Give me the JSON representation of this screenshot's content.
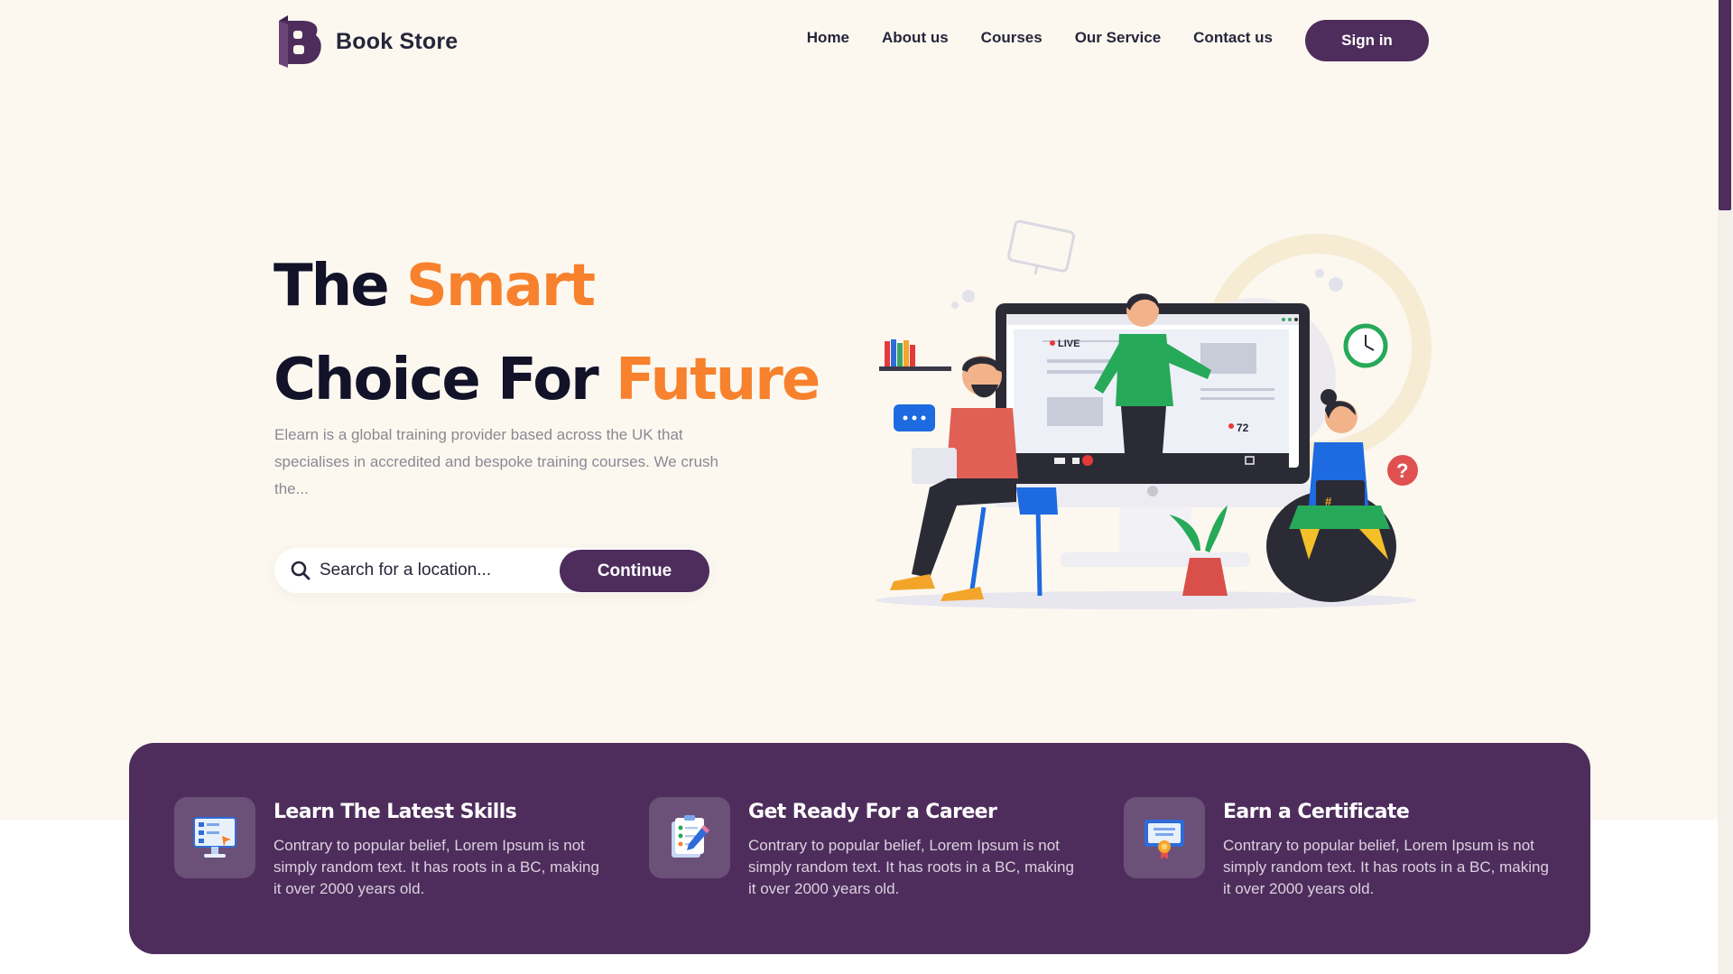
{
  "brand": {
    "name": "Book Store",
    "logo_letter": "B"
  },
  "nav": {
    "items": [
      "Home",
      "About us",
      "Courses",
      "Our Service",
      "Contact us"
    ],
    "signin_label": "Sign in"
  },
  "hero": {
    "headline_line1_plain": "The",
    "headline_line1_accent": "Smart",
    "headline_line2_plain": "Choice For",
    "headline_line2_accent": "Future",
    "description": "Elearn is a global training provider based across the UK that specialises in accredited and bespoke training courses. We crush the...",
    "search_placeholder": "Search for a location...",
    "continue_label": "Continue"
  },
  "illustration": {
    "live_label": "LIVE",
    "viewer_count": "72",
    "hashtag": "#",
    "question_mark": "?"
  },
  "features": [
    {
      "title": "Learn The Latest Skills",
      "text": "Contrary to popular belief, Lorem Ipsum is not simply random text. It has roots in a BC, making it over 2000 years old.",
      "icon": "monitor-lesson-icon"
    },
    {
      "title": "Get Ready For a Career",
      "text": "Contrary to popular belief, Lorem Ipsum is not simply random text. It has roots in a BC, making it over 2000 years old.",
      "icon": "checklist-pencil-icon"
    },
    {
      "title": "Earn a Certificate",
      "text": "Contrary to popular belief, Lorem Ipsum is not simply random text. It has roots in a BC, making it over 2000 years old.",
      "icon": "certificate-icon"
    }
  ],
  "colors": {
    "primary": "#4e2d5c",
    "accent": "#f7812c",
    "hero_bg": "#fcf8f0",
    "heading": "#121228"
  }
}
